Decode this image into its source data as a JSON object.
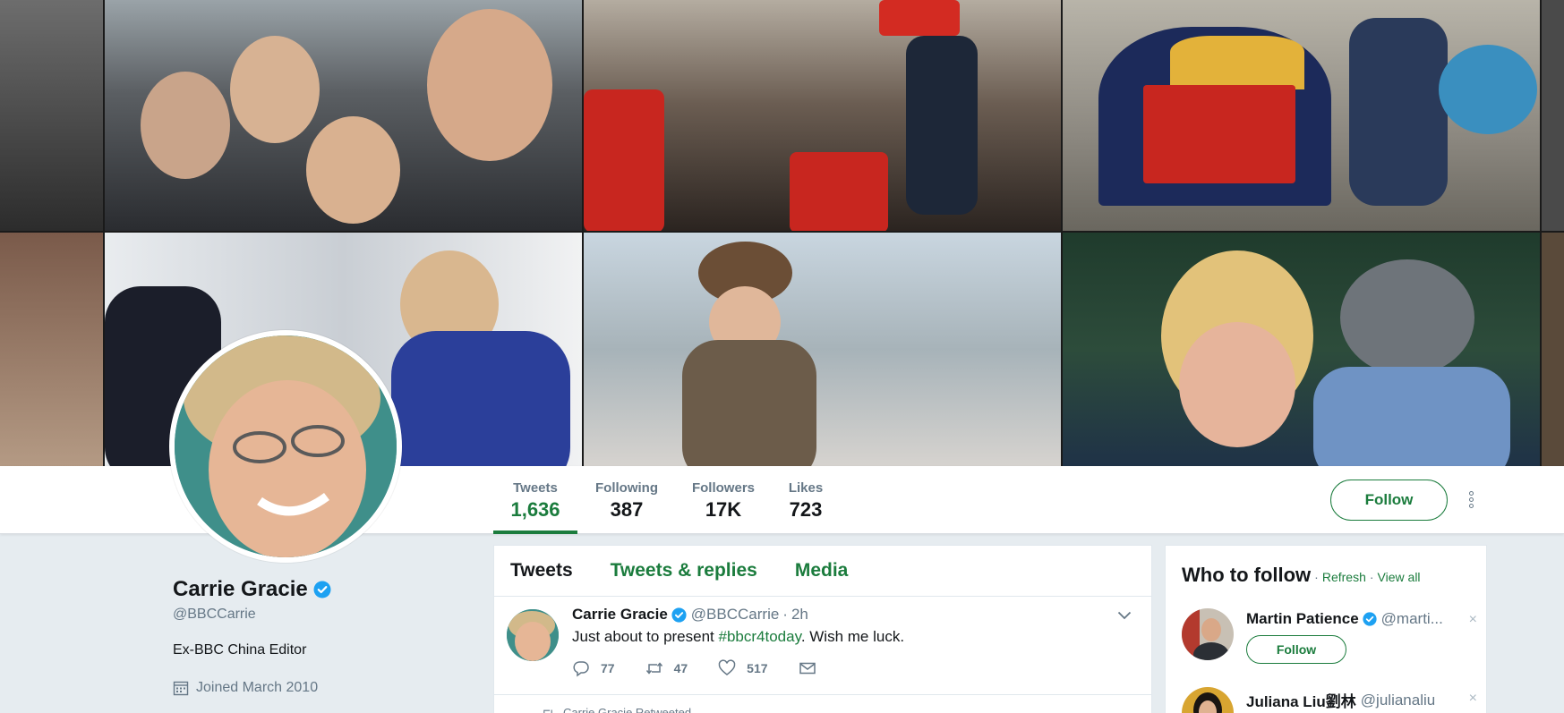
{
  "profile": {
    "name": "Carrie Gracie",
    "handle": "@BBCCarrie",
    "bio": "Ex-BBC China Editor",
    "joined": "Joined March 2010"
  },
  "stats": [
    {
      "label": "Tweets",
      "value": "1,636"
    },
    {
      "label": "Following",
      "value": "387"
    },
    {
      "label": "Followers",
      "value": "17K"
    },
    {
      "label": "Likes",
      "value": "723"
    }
  ],
  "follow_button": "Follow",
  "tabs": [
    "Tweets",
    "Tweets & replies",
    "Media"
  ],
  "tweet": {
    "name": "Carrie Gracie",
    "handle": "@BBCCarrie",
    "dot": "·",
    "time": "2h",
    "text_before": "Just about to present ",
    "hashtag": "#bbcr4today",
    "text_after": ". Wish me luck.",
    "replies": "77",
    "retweets": "47",
    "likes": "517"
  },
  "retweeted_note": "Carrie Gracie Retweeted",
  "who_to_follow": {
    "title": "Who to follow",
    "sep": "·",
    "refresh": "Refresh",
    "view_all": "View all",
    "users": [
      {
        "name": "Martin Patience",
        "handle": "@marti...",
        "follow": "Follow",
        "close": "×"
      },
      {
        "name": "Juliana Liu劉林",
        "handle": "@julianaliu",
        "close": "×"
      }
    ]
  },
  "colors": {
    "accent": "#1b7c3d",
    "verified": "#1da1f2",
    "secondary_text": "#657786"
  }
}
